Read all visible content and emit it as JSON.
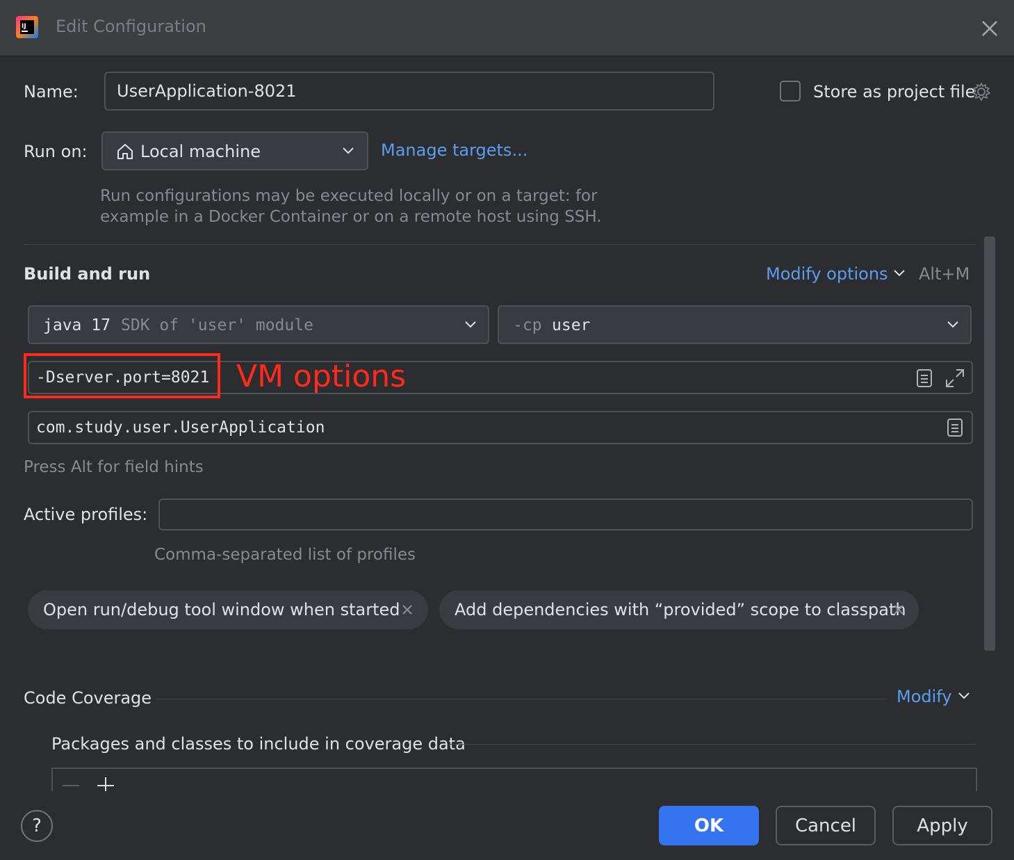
{
  "window": {
    "title": "Edit Configuration"
  },
  "name_row": {
    "label": "Name:",
    "value": "UserApplication-8021",
    "store_label": "Store as project file"
  },
  "run_on": {
    "label": "Run on:",
    "value": "Local machine",
    "manage_link": "Manage targets...",
    "hint_line1": "Run configurations may be executed locally or on a target: for",
    "hint_line2": "example in a Docker Container or on a remote host using SSH."
  },
  "build": {
    "heading": "Build and run",
    "modify_options": "Modify options",
    "shortcut": "Alt+M",
    "jdk_main": "java 17",
    "jdk_hint": "SDK of 'user' module",
    "cp_flag": "-cp",
    "cp_value": "user",
    "vm_options_value": "-Dserver.port=8021",
    "vm_annotation": "VM options",
    "main_class": "com.study.user.UserApplication",
    "field_hint": "Press Alt for field hints"
  },
  "profiles": {
    "label": "Active profiles:",
    "value": "",
    "hint": "Comma-separated list of profiles"
  },
  "chips": [
    {
      "label": "Open run/debug tool window when started"
    },
    {
      "label": "Add dependencies with “provided” scope to classpath"
    }
  ],
  "coverage": {
    "heading": "Code Coverage",
    "modify": "Modify",
    "packages_label": "Packages and classes to include in coverage data"
  },
  "footer": {
    "ok": "OK",
    "cancel": "Cancel",
    "apply": "Apply",
    "help": "?"
  },
  "colors": {
    "background": "#2b2d30",
    "link": "#5c9ded",
    "primary": "#3574f0",
    "annotation": "#ff2a1a"
  }
}
